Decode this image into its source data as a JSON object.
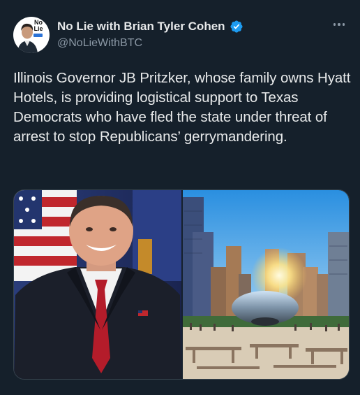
{
  "author": {
    "display_name": "No Lie with Brian Tyler Cohen",
    "handle": "@NoLieWithBTC",
    "avatar_logo": "No Lie",
    "verified": true,
    "verified_color": "#1d9bf0"
  },
  "tweet": {
    "text": "Illinois Governor JB Pritzker, whose family owns Hyatt Hotels, is providing logistical support to Texas Democrats who have fled the state under threat of arrest to stop Republicans’ gerrymandering."
  },
  "media": {
    "left_photo_icon": "portrait-photo",
    "right_photo_icon": "city-skyline-photo"
  },
  "colors": {
    "background": "#15202b",
    "text": "#e7e9ea",
    "secondary_text": "#8b98a5"
  }
}
